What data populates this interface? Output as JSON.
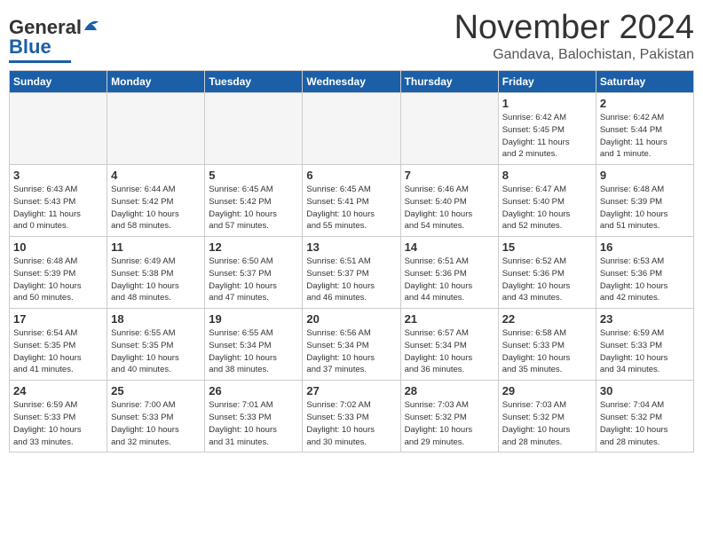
{
  "header": {
    "logo_general": "General",
    "logo_blue": "Blue",
    "month_title": "November 2024",
    "location": "Gandava, Balochistan, Pakistan"
  },
  "days_of_week": [
    "Sunday",
    "Monday",
    "Tuesday",
    "Wednesday",
    "Thursday",
    "Friday",
    "Saturday"
  ],
  "weeks": [
    [
      {
        "day": "",
        "info": ""
      },
      {
        "day": "",
        "info": ""
      },
      {
        "day": "",
        "info": ""
      },
      {
        "day": "",
        "info": ""
      },
      {
        "day": "",
        "info": ""
      },
      {
        "day": "1",
        "info": "Sunrise: 6:42 AM\nSunset: 5:45 PM\nDaylight: 11 hours\nand 2 minutes."
      },
      {
        "day": "2",
        "info": "Sunrise: 6:42 AM\nSunset: 5:44 PM\nDaylight: 11 hours\nand 1 minute."
      }
    ],
    [
      {
        "day": "3",
        "info": "Sunrise: 6:43 AM\nSunset: 5:43 PM\nDaylight: 11 hours\nand 0 minutes."
      },
      {
        "day": "4",
        "info": "Sunrise: 6:44 AM\nSunset: 5:42 PM\nDaylight: 10 hours\nand 58 minutes."
      },
      {
        "day": "5",
        "info": "Sunrise: 6:45 AM\nSunset: 5:42 PM\nDaylight: 10 hours\nand 57 minutes."
      },
      {
        "day": "6",
        "info": "Sunrise: 6:45 AM\nSunset: 5:41 PM\nDaylight: 10 hours\nand 55 minutes."
      },
      {
        "day": "7",
        "info": "Sunrise: 6:46 AM\nSunset: 5:40 PM\nDaylight: 10 hours\nand 54 minutes."
      },
      {
        "day": "8",
        "info": "Sunrise: 6:47 AM\nSunset: 5:40 PM\nDaylight: 10 hours\nand 52 minutes."
      },
      {
        "day": "9",
        "info": "Sunrise: 6:48 AM\nSunset: 5:39 PM\nDaylight: 10 hours\nand 51 minutes."
      }
    ],
    [
      {
        "day": "10",
        "info": "Sunrise: 6:48 AM\nSunset: 5:39 PM\nDaylight: 10 hours\nand 50 minutes."
      },
      {
        "day": "11",
        "info": "Sunrise: 6:49 AM\nSunset: 5:38 PM\nDaylight: 10 hours\nand 48 minutes."
      },
      {
        "day": "12",
        "info": "Sunrise: 6:50 AM\nSunset: 5:37 PM\nDaylight: 10 hours\nand 47 minutes."
      },
      {
        "day": "13",
        "info": "Sunrise: 6:51 AM\nSunset: 5:37 PM\nDaylight: 10 hours\nand 46 minutes."
      },
      {
        "day": "14",
        "info": "Sunrise: 6:51 AM\nSunset: 5:36 PM\nDaylight: 10 hours\nand 44 minutes."
      },
      {
        "day": "15",
        "info": "Sunrise: 6:52 AM\nSunset: 5:36 PM\nDaylight: 10 hours\nand 43 minutes."
      },
      {
        "day": "16",
        "info": "Sunrise: 6:53 AM\nSunset: 5:36 PM\nDaylight: 10 hours\nand 42 minutes."
      }
    ],
    [
      {
        "day": "17",
        "info": "Sunrise: 6:54 AM\nSunset: 5:35 PM\nDaylight: 10 hours\nand 41 minutes."
      },
      {
        "day": "18",
        "info": "Sunrise: 6:55 AM\nSunset: 5:35 PM\nDaylight: 10 hours\nand 40 minutes."
      },
      {
        "day": "19",
        "info": "Sunrise: 6:55 AM\nSunset: 5:34 PM\nDaylight: 10 hours\nand 38 minutes."
      },
      {
        "day": "20",
        "info": "Sunrise: 6:56 AM\nSunset: 5:34 PM\nDaylight: 10 hours\nand 37 minutes."
      },
      {
        "day": "21",
        "info": "Sunrise: 6:57 AM\nSunset: 5:34 PM\nDaylight: 10 hours\nand 36 minutes."
      },
      {
        "day": "22",
        "info": "Sunrise: 6:58 AM\nSunset: 5:33 PM\nDaylight: 10 hours\nand 35 minutes."
      },
      {
        "day": "23",
        "info": "Sunrise: 6:59 AM\nSunset: 5:33 PM\nDaylight: 10 hours\nand 34 minutes."
      }
    ],
    [
      {
        "day": "24",
        "info": "Sunrise: 6:59 AM\nSunset: 5:33 PM\nDaylight: 10 hours\nand 33 minutes."
      },
      {
        "day": "25",
        "info": "Sunrise: 7:00 AM\nSunset: 5:33 PM\nDaylight: 10 hours\nand 32 minutes."
      },
      {
        "day": "26",
        "info": "Sunrise: 7:01 AM\nSunset: 5:33 PM\nDaylight: 10 hours\nand 31 minutes."
      },
      {
        "day": "27",
        "info": "Sunrise: 7:02 AM\nSunset: 5:33 PM\nDaylight: 10 hours\nand 30 minutes."
      },
      {
        "day": "28",
        "info": "Sunrise: 7:03 AM\nSunset: 5:32 PM\nDaylight: 10 hours\nand 29 minutes."
      },
      {
        "day": "29",
        "info": "Sunrise: 7:03 AM\nSunset: 5:32 PM\nDaylight: 10 hours\nand 28 minutes."
      },
      {
        "day": "30",
        "info": "Sunrise: 7:04 AM\nSunset: 5:32 PM\nDaylight: 10 hours\nand 28 minutes."
      }
    ]
  ]
}
